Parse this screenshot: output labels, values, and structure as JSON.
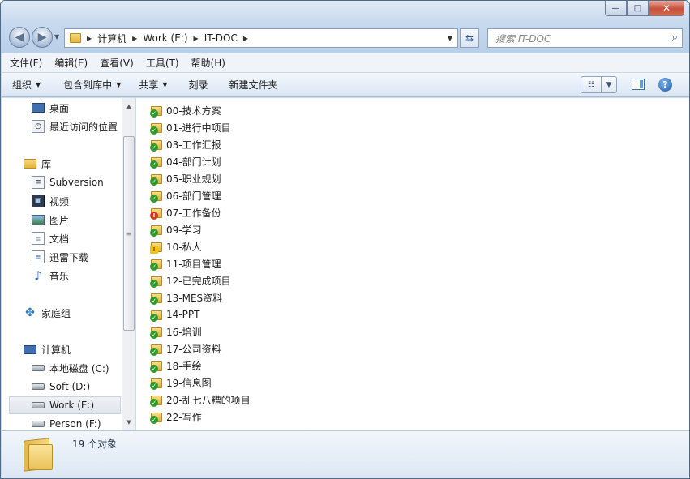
{
  "window": {
    "caption_buttons": {
      "minimize": "—",
      "maximize": "□",
      "close": "✕"
    }
  },
  "address": {
    "crumbs": [
      "计算机",
      "Work (E:)",
      "IT-DOC"
    ]
  },
  "search": {
    "placeholder": "搜索 IT-DOC"
  },
  "menubar": [
    "文件(F)",
    "编辑(E)",
    "查看(V)",
    "工具(T)",
    "帮助(H)"
  ],
  "toolbar": {
    "organize": "组织",
    "include_library": "包含到库中",
    "share": "共享",
    "burn": "刻录",
    "new_folder": "新建文件夹"
  },
  "navpane": {
    "items": [
      {
        "label": "桌面",
        "icon": "desktop-icon"
      },
      {
        "label": "最近访问的位置",
        "icon": "recent-places-icon"
      },
      {
        "label": "库",
        "icon": "library-icon"
      },
      {
        "label": "Subversion",
        "icon": "subversion-icon"
      },
      {
        "label": "视频",
        "icon": "video-icon"
      },
      {
        "label": "图片",
        "icon": "pictures-icon"
      },
      {
        "label": "文档",
        "icon": "documents-icon"
      },
      {
        "label": "迅雷下载",
        "icon": "download-icon"
      },
      {
        "label": "音乐",
        "icon": "music-icon"
      },
      {
        "label": "家庭组",
        "icon": "homegroup-icon"
      },
      {
        "label": "计算机",
        "icon": "computer-icon"
      },
      {
        "label": "本地磁盘 (C:)",
        "icon": "drive-icon"
      },
      {
        "label": "Soft (D:)",
        "icon": "drive-icon"
      },
      {
        "label": "Work (E:)",
        "icon": "drive-icon"
      },
      {
        "label": "Person (F:)",
        "icon": "drive-icon"
      }
    ]
  },
  "files": [
    {
      "name": "00-技术方案",
      "status": "ok"
    },
    {
      "name": "01-进行中项目",
      "status": "ok"
    },
    {
      "name": "03-工作汇报",
      "status": "ok"
    },
    {
      "name": "04-部门计划",
      "status": "ok"
    },
    {
      "name": "05-职业规划",
      "status": "ok"
    },
    {
      "name": "06-部门管理",
      "status": "ok"
    },
    {
      "name": "07-工作备份",
      "status": "error"
    },
    {
      "name": "09-学习",
      "status": "ok"
    },
    {
      "name": "10-私人",
      "status": "warning"
    },
    {
      "name": "11-项目管理",
      "status": "ok"
    },
    {
      "name": "12-已完成项目",
      "status": "ok"
    },
    {
      "name": "13-MES资料",
      "status": "ok"
    },
    {
      "name": "14-PPT",
      "status": "ok"
    },
    {
      "name": "16-培训",
      "status": "ok"
    },
    {
      "name": "17-公司资料",
      "status": "ok"
    },
    {
      "name": "18-手绘",
      "status": "ok"
    },
    {
      "name": "19-信息图",
      "status": "ok"
    },
    {
      "name": "20-乱七八糟的项目",
      "status": "ok"
    },
    {
      "name": "22-写作",
      "status": "ok"
    }
  ],
  "status": {
    "count_text": "19 个对象"
  }
}
